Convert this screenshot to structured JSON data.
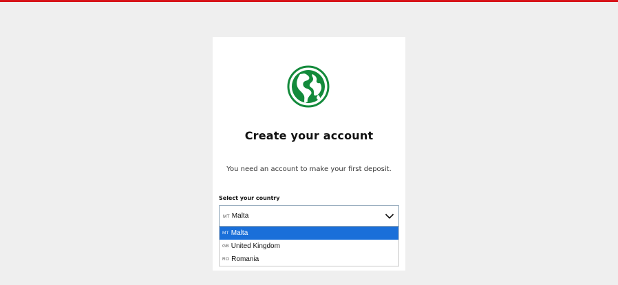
{
  "page": {
    "accent_color": "#d7141a",
    "brand_green": "#138a3b",
    "logo_icon": "globe-icon"
  },
  "card": {
    "title": "Create your account",
    "subtitle": "You need an account to make your first deposit."
  },
  "country_select": {
    "label": "Select your country",
    "selected": {
      "code": "MT",
      "name": "Malta"
    },
    "options": [
      {
        "code": "MT",
        "name": "Malta",
        "highlighted": true
      },
      {
        "code": "GB",
        "name": "United Kingdom",
        "highlighted": false
      },
      {
        "code": "RO",
        "name": "Romania",
        "highlighted": false
      }
    ],
    "chevron_icon": "chevron-down-icon"
  }
}
